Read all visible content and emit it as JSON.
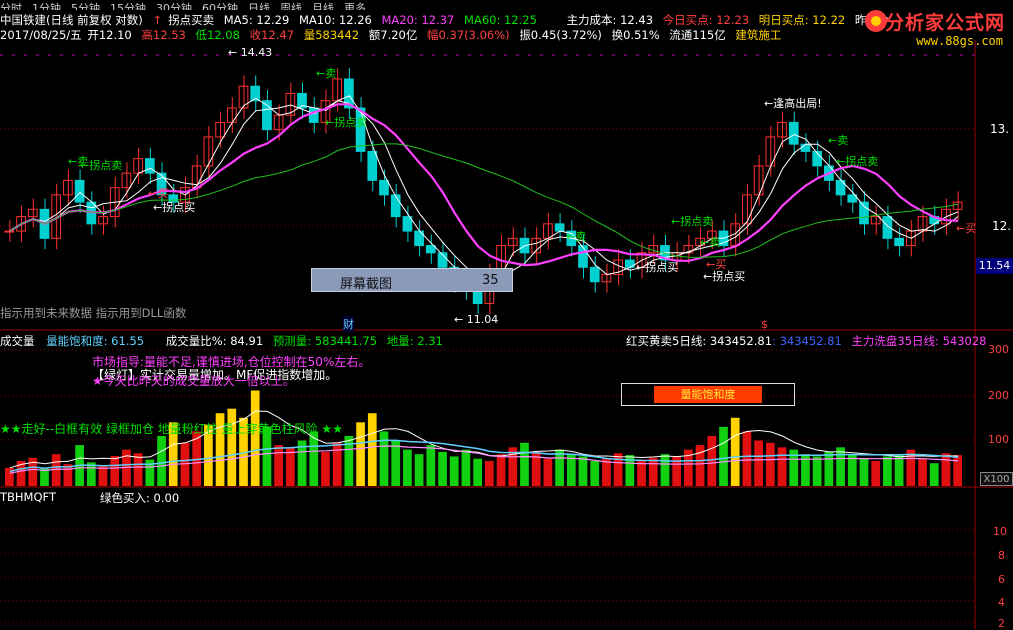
{
  "toolbar": {
    "items": [
      "分时",
      "1分钟",
      "5分钟",
      "15分钟",
      "30分钟",
      "60分钟",
      "日线",
      "周线",
      "月线",
      "更多"
    ]
  },
  "header": {
    "stock_name": "中国铁建(日线 前复权 对数)",
    "signal_label": "拐点买卖",
    "ma5": "MA5: 12.29",
    "ma10": "MA10: 12.26",
    "ma20": "MA20: 12.37",
    "ma60": "MA60: 12.25",
    "main_cost": "主力成本: 12.43",
    "today_buy": "今日买点: 12.23",
    "tomorrow_buy": "明日买点: 12.22",
    "yesterday": "昨则今"
  },
  "quote": {
    "date": "2017/08/25/五",
    "open": "开12.10",
    "high": "高12.53",
    "low": "低12.08",
    "close": "收12.47",
    "volume": "量583442",
    "amount": "额7.20亿",
    "change": "幅0.37(3.06%)",
    "amplitude": "振0.45(3.72%)",
    "turnover": "换0.51%",
    "float": "流通115亿",
    "industry": "建筑施工"
  },
  "logo": {
    "text": "分析家公式网",
    "url_text": "www.88gs.com"
  },
  "price_axis": [
    "13.",
    "12."
  ],
  "current_price": "11.54",
  "annotations": {
    "high": "← 14.43",
    "low": "← 11.04",
    "sell": "←卖",
    "buy": "←买",
    "inflect_sell": "←拐点卖",
    "inflect_buy": "←拐点买",
    "chase_high": "←逢高出局!",
    "fin": "财",
    "div": "$"
  },
  "notices": {
    "future_data": "指示用到未来数据 指示用到DLL函数"
  },
  "screenshot_tag": {
    "label": "屏幕截图",
    "value": "35"
  },
  "volume_panel": {
    "title": "成交量",
    "saturation": "量能饱和度: 61.55",
    "ratio": "成交量比%: 84.91",
    "forecast": "预测量: 583441.75",
    "ground": "地量: 2.31",
    "red_buy": "红买黄卖5日线: 343452.81",
    "blue_val": ": 343452.81",
    "wash": "主力洗盘35日线: 543028",
    "msg1": "市场指导:量能不足,谨慎进场,仓位控制在50%左右。",
    "msg2": "【绿灯】实计交易量增加。MF促进指数增加。",
    "msg3": "★今天比昨天的成交量放大一倍以上。",
    "legend": "★★走好--白框有效 绿框加仓 地量粉红柱 量上穿黄色柱风险 ★★",
    "warn": "量能饱和度",
    "axis": [
      "300",
      "200",
      "100"
    ],
    "scale": "X100"
  },
  "bottom_panel": {
    "name": "TBHMQFT",
    "green_buy": "绿色买入: 0.00",
    "axis": [
      "10",
      "8",
      "6",
      "4",
      "2"
    ]
  },
  "chart_data": {
    "type": "candlestick",
    "price_range": [
      10.9,
      14.6
    ],
    "candles": [
      12.1,
      12.3,
      12.4,
      12.0,
      12.6,
      12.8,
      12.5,
      12.2,
      12.3,
      12.7,
      12.9,
      13.1,
      12.9,
      12.6,
      12.5,
      12.7,
      13.0,
      13.4,
      13.6,
      13.8,
      14.1,
      13.9,
      13.5,
      13.7,
      14.0,
      13.8,
      13.6,
      13.9,
      14.2,
      13.8,
      13.2,
      12.8,
      12.6,
      12.3,
      12.1,
      11.9,
      11.8,
      11.6,
      11.4,
      11.3,
      11.1,
      11.5,
      11.9,
      12.0,
      11.8,
      12.0,
      12.2,
      12.1,
      11.9,
      11.6,
      11.4,
      11.5,
      11.7,
      11.6,
      11.8,
      11.9,
      11.7,
      11.8,
      11.9,
      12.0,
      12.1,
      11.9,
      12.2,
      12.6,
      13.0,
      13.4,
      13.6,
      13.3,
      13.2,
      13.0,
      12.8,
      12.6,
      12.5,
      12.2,
      12.3,
      12.0,
      11.9,
      12.1,
      12.3,
      12.2,
      12.4,
      12.5
    ],
    "volumes": [
      40,
      55,
      62,
      38,
      70,
      48,
      90,
      52,
      44,
      66,
      80,
      72,
      58,
      110,
      140,
      95,
      120,
      135,
      160,
      170,
      150,
      210,
      130,
      90,
      85,
      100,
      120,
      75,
      95,
      110,
      140,
      160,
      120,
      100,
      80,
      70,
      90,
      75,
      65,
      80,
      60,
      55,
      70,
      85,
      95,
      75,
      60,
      80,
      70,
      65,
      55,
      60,
      72,
      68,
      58,
      62,
      70,
      65,
      80,
      90,
      110,
      130,
      150,
      120,
      100,
      95,
      85,
      80,
      70,
      65,
      75,
      85,
      70,
      60,
      55,
      65,
      70,
      80,
      60,
      50,
      72,
      68
    ]
  }
}
